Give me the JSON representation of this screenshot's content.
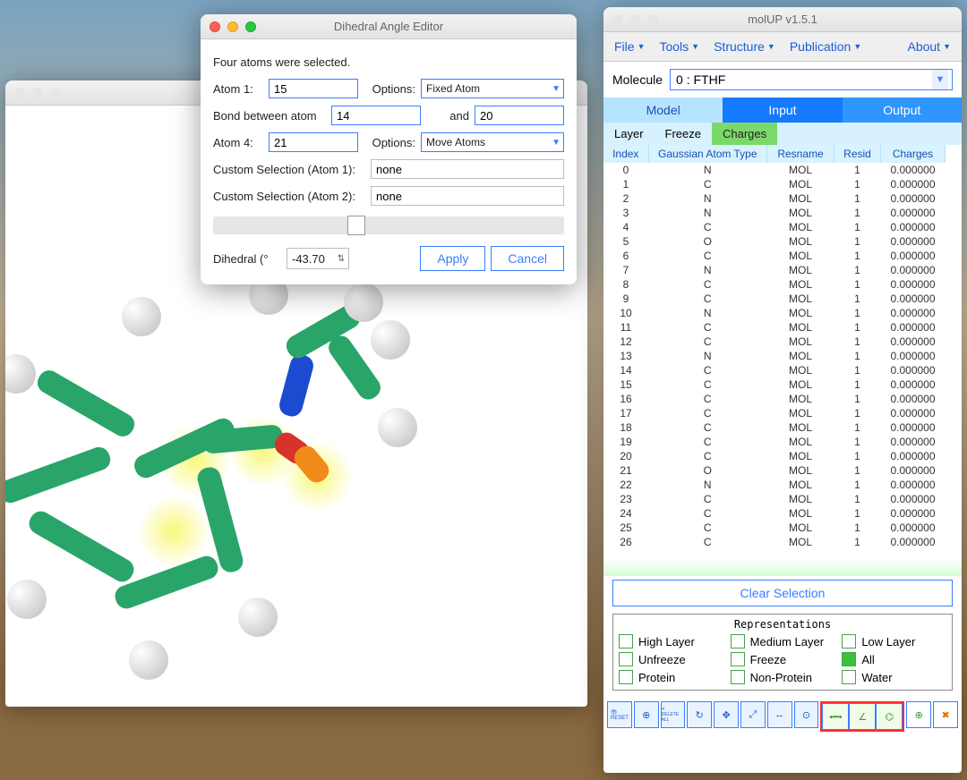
{
  "dihedral_editor": {
    "title": "Dihedral Angle Editor",
    "info_text": "Four atoms were selected.",
    "labels": {
      "atom1": "Atom 1:",
      "bond_between": "Bond between atom",
      "and": "and",
      "atom4": "Atom 4:",
      "options": "Options:",
      "custom1": "Custom Selection (Atom 1):",
      "custom2": "Custom Selection (Atom 2):",
      "dihedral": "Dihedral (°"
    },
    "atom1_value": "15",
    "bond_a_value": "14",
    "bond_b_value": "20",
    "atom4_value": "21",
    "option1_value": "Fixed Atom",
    "option2_value": "Move Atoms",
    "custom1_value": "none",
    "custom2_value": "none",
    "dihedral_value": "-43.70",
    "apply_label": "Apply",
    "cancel_label": "Cancel"
  },
  "molup": {
    "title": "molUP v1.5.1",
    "menus": {
      "file": "File",
      "tools": "Tools",
      "structure": "Structure",
      "publication": "Publication",
      "about": "About"
    },
    "molecule_label": "Molecule",
    "molecule_value": "0 : FTHF",
    "mio": {
      "model": "Model",
      "input": "Input",
      "output": "Output"
    },
    "subtabs": {
      "layer": "Layer",
      "freeze": "Freeze",
      "charges": "Charges"
    },
    "table_headers": {
      "index": "Index",
      "type": "Gaussian Atom Type",
      "resname": "Resname",
      "resid": "Resid",
      "charges": "Charges"
    },
    "rows": [
      {
        "i": "0",
        "t": "N",
        "rn": "MOL",
        "ri": "1",
        "c": "0.000000"
      },
      {
        "i": "1",
        "t": "C",
        "rn": "MOL",
        "ri": "1",
        "c": "0.000000"
      },
      {
        "i": "2",
        "t": "N",
        "rn": "MOL",
        "ri": "1",
        "c": "0.000000"
      },
      {
        "i": "3",
        "t": "N",
        "rn": "MOL",
        "ri": "1",
        "c": "0.000000"
      },
      {
        "i": "4",
        "t": "C",
        "rn": "MOL",
        "ri": "1",
        "c": "0.000000"
      },
      {
        "i": "5",
        "t": "O",
        "rn": "MOL",
        "ri": "1",
        "c": "0.000000"
      },
      {
        "i": "6",
        "t": "C",
        "rn": "MOL",
        "ri": "1",
        "c": "0.000000"
      },
      {
        "i": "7",
        "t": "N",
        "rn": "MOL",
        "ri": "1",
        "c": "0.000000"
      },
      {
        "i": "8",
        "t": "C",
        "rn": "MOL",
        "ri": "1",
        "c": "0.000000"
      },
      {
        "i": "9",
        "t": "C",
        "rn": "MOL",
        "ri": "1",
        "c": "0.000000"
      },
      {
        "i": "10",
        "t": "N",
        "rn": "MOL",
        "ri": "1",
        "c": "0.000000"
      },
      {
        "i": "11",
        "t": "C",
        "rn": "MOL",
        "ri": "1",
        "c": "0.000000"
      },
      {
        "i": "12",
        "t": "C",
        "rn": "MOL",
        "ri": "1",
        "c": "0.000000"
      },
      {
        "i": "13",
        "t": "N",
        "rn": "MOL",
        "ri": "1",
        "c": "0.000000"
      },
      {
        "i": "14",
        "t": "C",
        "rn": "MOL",
        "ri": "1",
        "c": "0.000000"
      },
      {
        "i": "15",
        "t": "C",
        "rn": "MOL",
        "ri": "1",
        "c": "0.000000"
      },
      {
        "i": "16",
        "t": "C",
        "rn": "MOL",
        "ri": "1",
        "c": "0.000000"
      },
      {
        "i": "17",
        "t": "C",
        "rn": "MOL",
        "ri": "1",
        "c": "0.000000"
      },
      {
        "i": "18",
        "t": "C",
        "rn": "MOL",
        "ri": "1",
        "c": "0.000000"
      },
      {
        "i": "19",
        "t": "C",
        "rn": "MOL",
        "ri": "1",
        "c": "0.000000"
      },
      {
        "i": "20",
        "t": "C",
        "rn": "MOL",
        "ri": "1",
        "c": "0.000000"
      },
      {
        "i": "21",
        "t": "O",
        "rn": "MOL",
        "ri": "1",
        "c": "0.000000"
      },
      {
        "i": "22",
        "t": "N",
        "rn": "MOL",
        "ri": "1",
        "c": "0.000000"
      },
      {
        "i": "23",
        "t": "C",
        "rn": "MOL",
        "ri": "1",
        "c": "0.000000"
      },
      {
        "i": "24",
        "t": "C",
        "rn": "MOL",
        "ri": "1",
        "c": "0.000000"
      },
      {
        "i": "25",
        "t": "C",
        "rn": "MOL",
        "ri": "1",
        "c": "0.000000"
      },
      {
        "i": "26",
        "t": "C",
        "rn": "MOL",
        "ri": "1",
        "c": "0.000000"
      }
    ],
    "clear_label": "Clear Selection",
    "reps_title": "Representations",
    "reps": {
      "high": "High Layer",
      "medium": "Medium Layer",
      "low": "Low Layer",
      "unfreeze": "Unfreeze",
      "freeze": "Freeze",
      "all": "All",
      "protein": "Protein",
      "nonprotein": "Non-Protein",
      "water": "Water"
    },
    "tool_labels": {
      "reset": "RESET",
      "delete_all": "DELETE ALL"
    }
  }
}
